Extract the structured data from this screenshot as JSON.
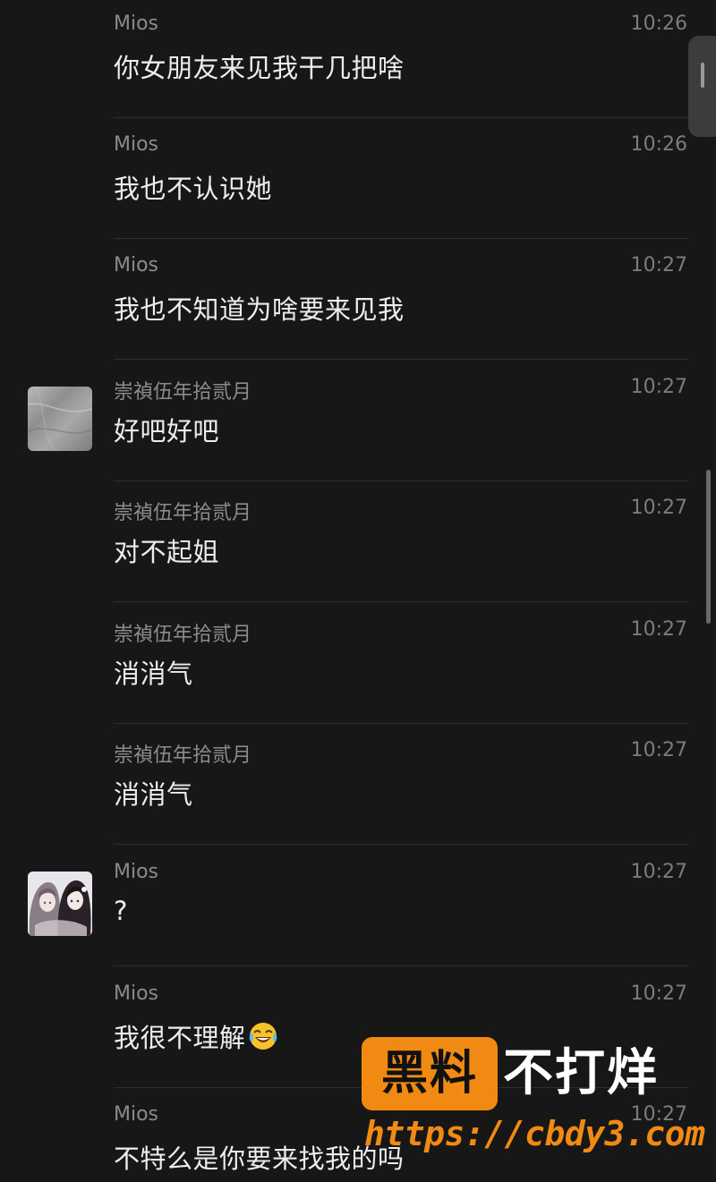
{
  "messages": [
    {
      "sender": "Mios",
      "time": "10:26",
      "text": "你女朋友来见我干几把啥",
      "avatar": null
    },
    {
      "sender": "Mios",
      "time": "10:26",
      "text": "我也不认识她",
      "avatar": null
    },
    {
      "sender": "Mios",
      "time": "10:27",
      "text": "我也不知道为啥要来见我",
      "avatar": null
    },
    {
      "sender": "崇禎伍年拾贰月",
      "time": "10:27",
      "text": "好吧好吧",
      "avatar": "marble-avatar"
    },
    {
      "sender": "崇禎伍年拾贰月",
      "time": "10:27",
      "text": "对不起姐",
      "avatar": null
    },
    {
      "sender": "崇禎伍年拾贰月",
      "time": "10:27",
      "text": "消消气",
      "avatar": null
    },
    {
      "sender": "崇禎伍年拾贰月",
      "time": "10:27",
      "text": "消消气",
      "avatar": null
    },
    {
      "sender": "Mios",
      "time": "10:27",
      "text": "?",
      "avatar": "anime-girl-avatar"
    },
    {
      "sender": "Mios",
      "time": "10:27",
      "text": "我很不理解",
      "avatar": null,
      "emoji": "crying-laughing-emoji"
    },
    {
      "sender": "Mios",
      "time": "10:27",
      "text": "不特么是你要来找我的吗",
      "avatar": null
    }
  ],
  "watermark": {
    "badge": "黑料",
    "slogan": "不打烊",
    "url": "https://cbdy3.com"
  },
  "colors": {
    "background": "#171717",
    "message_text": "#ededed",
    "meta_text": "#8b8b8b",
    "watermark_orange": "#f08a12"
  }
}
